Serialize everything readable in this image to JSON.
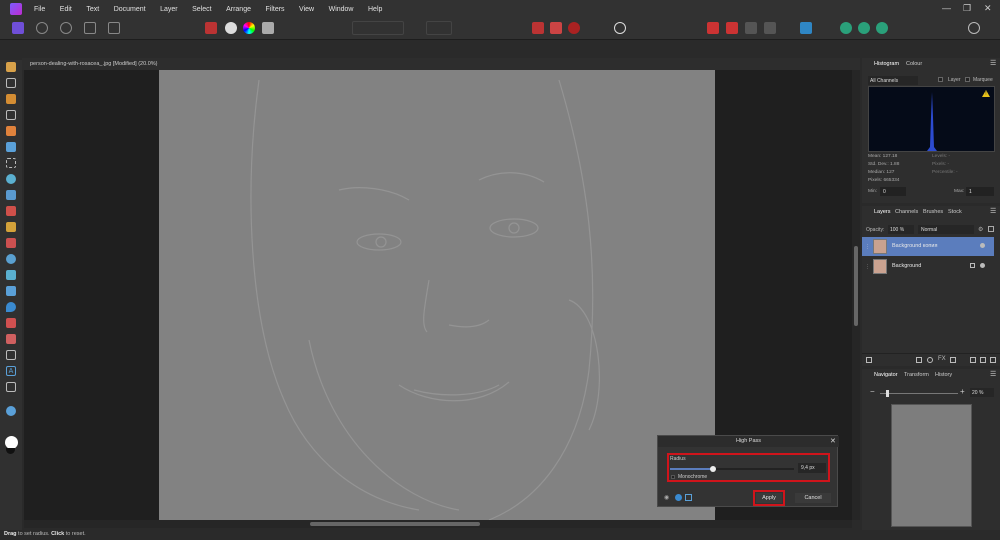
{
  "menubar": {
    "items": [
      "File",
      "Edit",
      "Text",
      "Document",
      "Layer",
      "Select",
      "Arrange",
      "Filters",
      "View",
      "Window",
      "Help"
    ]
  },
  "document": {
    "tab_title": "person-dealing-with-rosacea_.jpg [Modified] (20.0%)"
  },
  "histogram": {
    "tabs": [
      "Histogram",
      "Colour"
    ],
    "channel_select": "All Channels",
    "layer_label": "Layer",
    "marquee_label": "Marquee",
    "warning_icon": "!",
    "stats_left": [
      "Mean: 127.18",
      "Std. Dev.: 1.88",
      "Median: 127",
      "Pixels: 665334"
    ],
    "stats_right": [
      "Levels: -",
      "Pixels: -",
      "Percentile: -"
    ],
    "min_label": "Min:",
    "min_value": "0",
    "max_label": "Max:",
    "max_value": "1"
  },
  "layers": {
    "tabs": [
      "Layers",
      "Channels",
      "Brushes",
      "Stock"
    ],
    "opacity_label": "Opacity:",
    "opacity_value": "100 %",
    "blend_mode": "Normal",
    "items": [
      {
        "name": "Background копия",
        "selected": true
      },
      {
        "name": "Background",
        "selected": false
      }
    ]
  },
  "navigator": {
    "tabs": [
      "Navigator",
      "Transform",
      "History"
    ],
    "zoom_value": "20 %"
  },
  "dialog": {
    "title": "High Pass",
    "radius_label": "Radius",
    "radius_value": "9,4 px",
    "radius_fraction": 0.35,
    "monochrome_label": "Monochrome",
    "apply_label": "Apply",
    "cancel_label": "Cancel"
  },
  "status": {
    "action1": "Drag",
    "text1": " to set radius. ",
    "action2": "Click",
    "text2": " to reset."
  },
  "colors": {
    "accent": "#5b7dbd",
    "highlight": "#d0141b",
    "photo_gray": "#828282"
  }
}
